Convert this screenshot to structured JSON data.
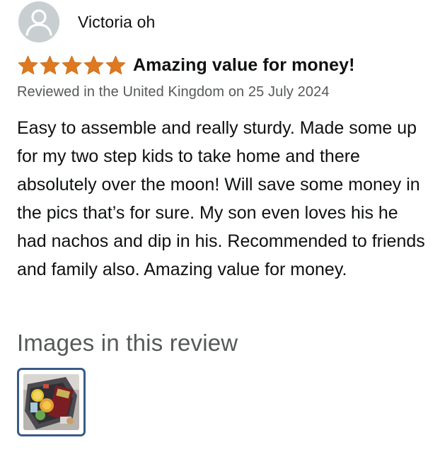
{
  "reviewer": {
    "name": "Victoria oh",
    "avatar_icon": "default-user-avatar-icon"
  },
  "rating": {
    "stars": 5,
    "max": 5,
    "color": "#de7921",
    "icon": "star-icon"
  },
  "review": {
    "title": "Amazing value for money!",
    "meta": "Reviewed in the United Kingdom on 25 July 2024",
    "body": "Easy to assemble and really sturdy. Made some up for my two step kids to take home and there absolutely over the moon! Will save some money in the pics that’s for sure. My son even loves his he had nachos and dip in his. Recommended to friends and family also. Amazing value for money."
  },
  "images": {
    "heading": "Images in this review",
    "thumbnails": [
      {
        "name": "review-image-1",
        "border_color": "#3a5a86"
      }
    ]
  }
}
